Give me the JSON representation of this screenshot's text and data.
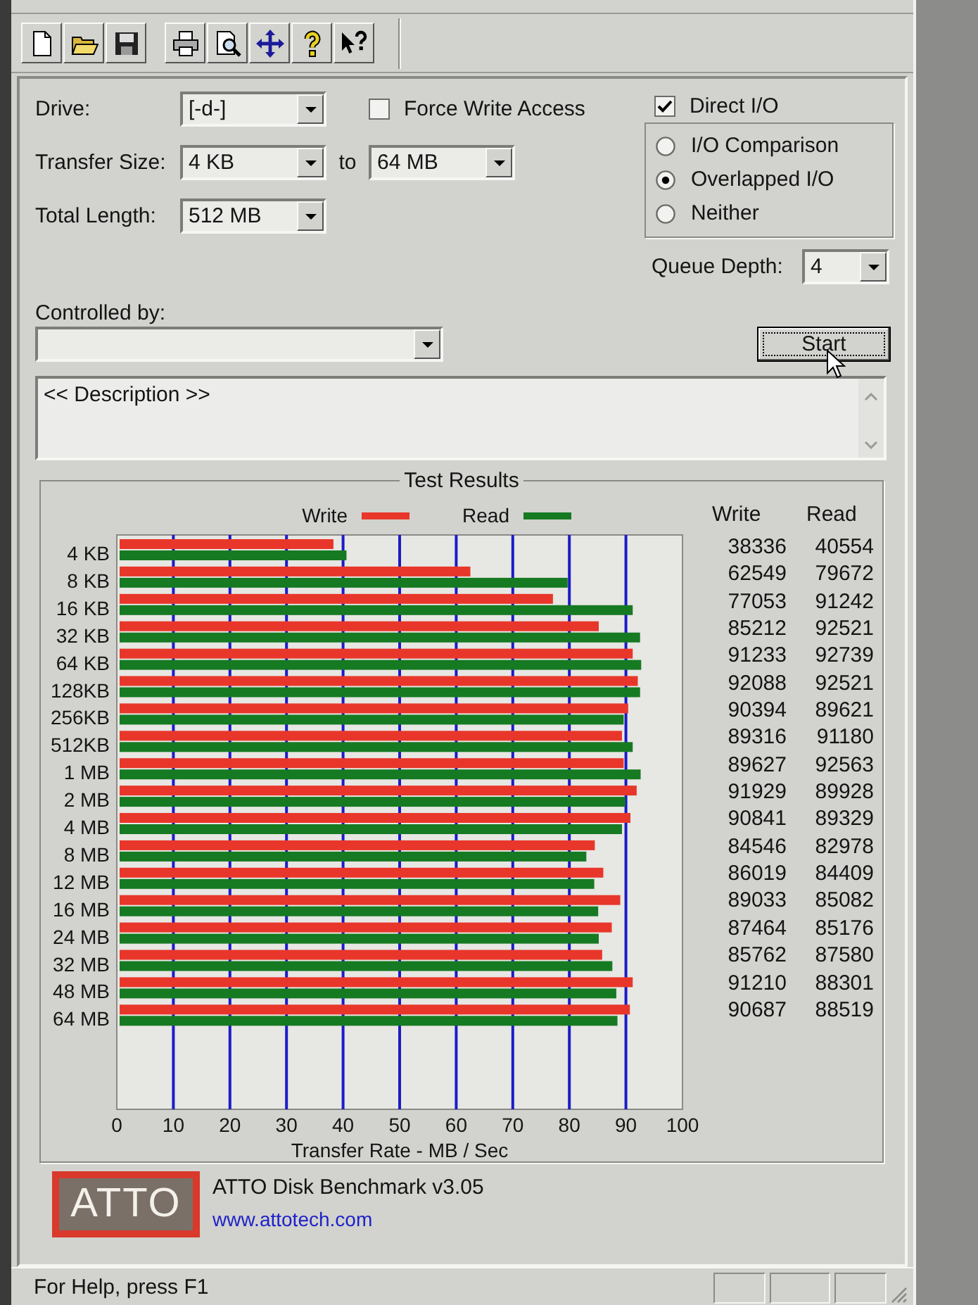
{
  "toolbar": {
    "groups": [
      [
        {
          "kind": "new"
        },
        {
          "kind": "open"
        },
        {
          "kind": "save"
        }
      ],
      [
        {
          "kind": "print"
        },
        {
          "kind": "preview"
        },
        {
          "kind": "move"
        },
        {
          "kind": "help"
        },
        {
          "kind": "context_help"
        }
      ]
    ]
  },
  "settings": {
    "drive": {
      "label": "Drive:",
      "value": "[-d-]"
    },
    "force_write_access": {
      "label": "Force Write Access",
      "checked": false
    },
    "direct_io": {
      "label": "Direct I/O",
      "checked": true
    },
    "transfer_size": {
      "label": "Transfer Size:",
      "from": "4 KB",
      "to_label": "to",
      "to": "64 MB"
    },
    "total_length": {
      "label": "Total Length:",
      "value": "512 MB"
    },
    "io_modes": [
      {
        "label": "I/O Comparison",
        "selected": false
      },
      {
        "label": "Overlapped I/O",
        "selected": true
      },
      {
        "label": "Neither",
        "selected": false
      }
    ],
    "queue_depth": {
      "label": "Queue Depth:",
      "value": "4"
    },
    "controlled_by": {
      "label": "Controlled by:"
    },
    "start_button": {
      "label": "Start"
    },
    "description": {
      "value": "<< Description >>"
    }
  },
  "test_results": {
    "title": "Test Results",
    "chart_data": {
      "type": "bar",
      "orientation": "horizontal",
      "xlabel": "Transfer Rate - MB / Sec",
      "categories": [
        "4 KB",
        "8 KB",
        "16 KB",
        "32 KB",
        "64 KB",
        "128KB",
        "256KB",
        "512KB",
        "1 MB",
        "2 MB",
        "4 MB",
        "8 MB",
        "12 MB",
        "16 MB",
        "24 MB",
        "32 MB",
        "48 MB",
        "64 MB"
      ],
      "series": [
        {
          "name": "Write",
          "color": "#e8372a",
          "values": [
            38.3,
            62.5,
            77.1,
            85.2,
            91.2,
            92.1,
            90.4,
            89.3,
            89.6,
            91.9,
            90.8,
            84.5,
            86.0,
            89.0,
            87.5,
            85.8,
            91.2,
            90.7
          ]
        },
        {
          "name": "Read",
          "color": "#167a22",
          "values": [
            40.6,
            79.7,
            91.2,
            92.5,
            92.7,
            92.5,
            89.6,
            91.2,
            92.6,
            89.9,
            89.3,
            83.0,
            84.4,
            85.1,
            85.2,
            87.6,
            88.3,
            88.5
          ]
        }
      ],
      "xlim": [
        0,
        100
      ],
      "xticks": [
        0,
        10,
        20,
        30,
        40,
        50,
        60,
        70,
        80,
        90,
        100
      ],
      "grid": true,
      "legend": true
    },
    "table": {
      "columns": [
        "Write",
        "Read"
      ],
      "rows": [
        [
          "38336",
          "40554"
        ],
        [
          "62549",
          "79672"
        ],
        [
          "77053",
          "91242"
        ],
        [
          "85212",
          "92521"
        ],
        [
          "91233",
          "92739"
        ],
        [
          "92088",
          "92521"
        ],
        [
          "90394",
          "89621"
        ],
        [
          "89316",
          "91180"
        ],
        [
          "89627",
          "92563"
        ],
        [
          "91929",
          "89928"
        ],
        [
          "90841",
          "89329"
        ],
        [
          "84546",
          "82978"
        ],
        [
          "86019",
          "84409"
        ],
        [
          "89033",
          "85082"
        ],
        [
          "87464",
          "85176"
        ],
        [
          "85762",
          "87580"
        ],
        [
          "91210",
          "88301"
        ],
        [
          "90687",
          "88519"
        ]
      ]
    }
  },
  "about": {
    "logo": "ATTO",
    "product": "ATTO Disk Benchmark v3.05",
    "link": "www.attotech.com"
  },
  "status_bar": {
    "text": "For Help, press F1"
  }
}
